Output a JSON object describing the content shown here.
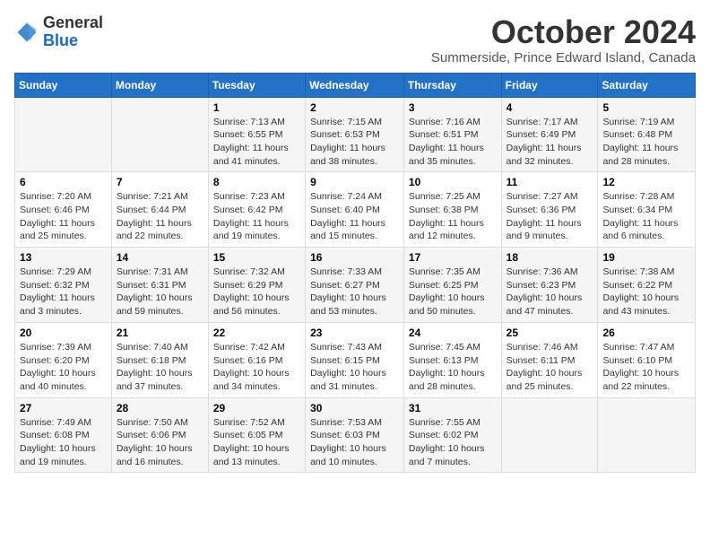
{
  "logo": {
    "general": "General",
    "blue": "Blue"
  },
  "title": "October 2024",
  "subtitle": "Summerside, Prince Edward Island, Canada",
  "days_of_week": [
    "Sunday",
    "Monday",
    "Tuesday",
    "Wednesday",
    "Thursday",
    "Friday",
    "Saturday"
  ],
  "weeks": [
    [
      {
        "day": "",
        "info": ""
      },
      {
        "day": "",
        "info": ""
      },
      {
        "day": "1",
        "info": "Sunrise: 7:13 AM\nSunset: 6:55 PM\nDaylight: 11 hours and 41 minutes."
      },
      {
        "day": "2",
        "info": "Sunrise: 7:15 AM\nSunset: 6:53 PM\nDaylight: 11 hours and 38 minutes."
      },
      {
        "day": "3",
        "info": "Sunrise: 7:16 AM\nSunset: 6:51 PM\nDaylight: 11 hours and 35 minutes."
      },
      {
        "day": "4",
        "info": "Sunrise: 7:17 AM\nSunset: 6:49 PM\nDaylight: 11 hours and 32 minutes."
      },
      {
        "day": "5",
        "info": "Sunrise: 7:19 AM\nSunset: 6:48 PM\nDaylight: 11 hours and 28 minutes."
      }
    ],
    [
      {
        "day": "6",
        "info": "Sunrise: 7:20 AM\nSunset: 6:46 PM\nDaylight: 11 hours and 25 minutes."
      },
      {
        "day": "7",
        "info": "Sunrise: 7:21 AM\nSunset: 6:44 PM\nDaylight: 11 hours and 22 minutes."
      },
      {
        "day": "8",
        "info": "Sunrise: 7:23 AM\nSunset: 6:42 PM\nDaylight: 11 hours and 19 minutes."
      },
      {
        "day": "9",
        "info": "Sunrise: 7:24 AM\nSunset: 6:40 PM\nDaylight: 11 hours and 15 minutes."
      },
      {
        "day": "10",
        "info": "Sunrise: 7:25 AM\nSunset: 6:38 PM\nDaylight: 11 hours and 12 minutes."
      },
      {
        "day": "11",
        "info": "Sunrise: 7:27 AM\nSunset: 6:36 PM\nDaylight: 11 hours and 9 minutes."
      },
      {
        "day": "12",
        "info": "Sunrise: 7:28 AM\nSunset: 6:34 PM\nDaylight: 11 hours and 6 minutes."
      }
    ],
    [
      {
        "day": "13",
        "info": "Sunrise: 7:29 AM\nSunset: 6:32 PM\nDaylight: 11 hours and 3 minutes."
      },
      {
        "day": "14",
        "info": "Sunrise: 7:31 AM\nSunset: 6:31 PM\nDaylight: 10 hours and 59 minutes."
      },
      {
        "day": "15",
        "info": "Sunrise: 7:32 AM\nSunset: 6:29 PM\nDaylight: 10 hours and 56 minutes."
      },
      {
        "day": "16",
        "info": "Sunrise: 7:33 AM\nSunset: 6:27 PM\nDaylight: 10 hours and 53 minutes."
      },
      {
        "day": "17",
        "info": "Sunrise: 7:35 AM\nSunset: 6:25 PM\nDaylight: 10 hours and 50 minutes."
      },
      {
        "day": "18",
        "info": "Sunrise: 7:36 AM\nSunset: 6:23 PM\nDaylight: 10 hours and 47 minutes."
      },
      {
        "day": "19",
        "info": "Sunrise: 7:38 AM\nSunset: 6:22 PM\nDaylight: 10 hours and 43 minutes."
      }
    ],
    [
      {
        "day": "20",
        "info": "Sunrise: 7:39 AM\nSunset: 6:20 PM\nDaylight: 10 hours and 40 minutes."
      },
      {
        "day": "21",
        "info": "Sunrise: 7:40 AM\nSunset: 6:18 PM\nDaylight: 10 hours and 37 minutes."
      },
      {
        "day": "22",
        "info": "Sunrise: 7:42 AM\nSunset: 6:16 PM\nDaylight: 10 hours and 34 minutes."
      },
      {
        "day": "23",
        "info": "Sunrise: 7:43 AM\nSunset: 6:15 PM\nDaylight: 10 hours and 31 minutes."
      },
      {
        "day": "24",
        "info": "Sunrise: 7:45 AM\nSunset: 6:13 PM\nDaylight: 10 hours and 28 minutes."
      },
      {
        "day": "25",
        "info": "Sunrise: 7:46 AM\nSunset: 6:11 PM\nDaylight: 10 hours and 25 minutes."
      },
      {
        "day": "26",
        "info": "Sunrise: 7:47 AM\nSunset: 6:10 PM\nDaylight: 10 hours and 22 minutes."
      }
    ],
    [
      {
        "day": "27",
        "info": "Sunrise: 7:49 AM\nSunset: 6:08 PM\nDaylight: 10 hours and 19 minutes."
      },
      {
        "day": "28",
        "info": "Sunrise: 7:50 AM\nSunset: 6:06 PM\nDaylight: 10 hours and 16 minutes."
      },
      {
        "day": "29",
        "info": "Sunrise: 7:52 AM\nSunset: 6:05 PM\nDaylight: 10 hours and 13 minutes."
      },
      {
        "day": "30",
        "info": "Sunrise: 7:53 AM\nSunset: 6:03 PM\nDaylight: 10 hours and 10 minutes."
      },
      {
        "day": "31",
        "info": "Sunrise: 7:55 AM\nSunset: 6:02 PM\nDaylight: 10 hours and 7 minutes."
      },
      {
        "day": "",
        "info": ""
      },
      {
        "day": "",
        "info": ""
      }
    ]
  ]
}
